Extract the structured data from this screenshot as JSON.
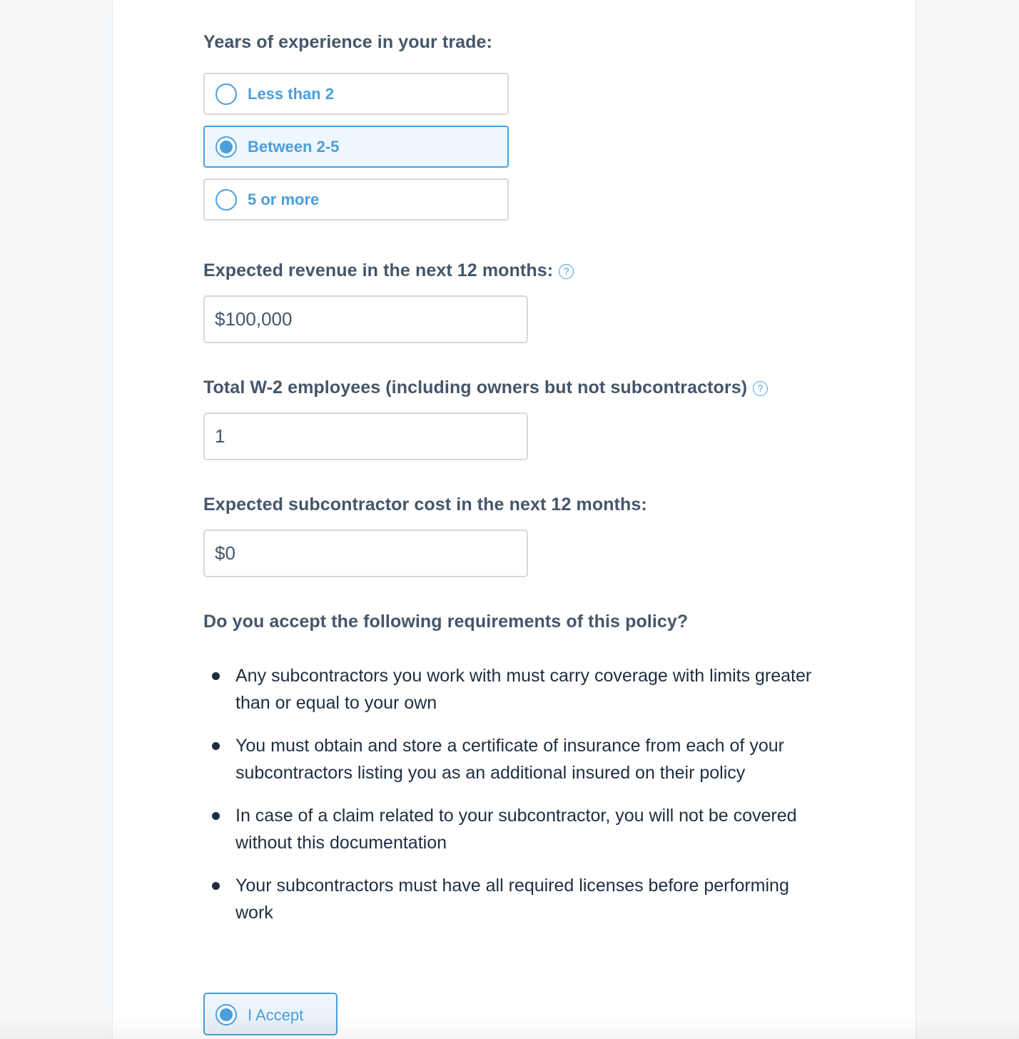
{
  "experience": {
    "label": "Years of experience in your trade:",
    "options": [
      {
        "label": "Less than 2",
        "selected": false
      },
      {
        "label": "Between 2-5",
        "selected": true
      },
      {
        "label": "5 or more",
        "selected": false
      }
    ]
  },
  "revenue": {
    "label": "Expected revenue in the next 12 months:",
    "help_icon": "?",
    "value": "$100,000"
  },
  "employees": {
    "label": "Total W-2 employees (including owners but not subcontractors)",
    "help_icon": "?",
    "value": "1"
  },
  "subcontractor_cost": {
    "label": "Expected subcontractor cost in the next 12 months:",
    "value": "$0"
  },
  "requirements": {
    "question": "Do you accept the following requirements of this policy?",
    "items": [
      "Any subcontractors you work with must carry coverage with limits greater than or equal to your own",
      "You must obtain and store a certificate of insurance from each of your subcontractors listing you as an additional insured on their policy",
      "In case of a claim related to your subcontractor, you will not be covered without this documentation",
      "Your subcontractors must have all required licenses before performing work"
    ],
    "accept_label": "I Accept",
    "accepted": true
  },
  "colors": {
    "accent": "#4a9fdc",
    "label_text": "#45566a",
    "body_text": "#1e2e40"
  }
}
